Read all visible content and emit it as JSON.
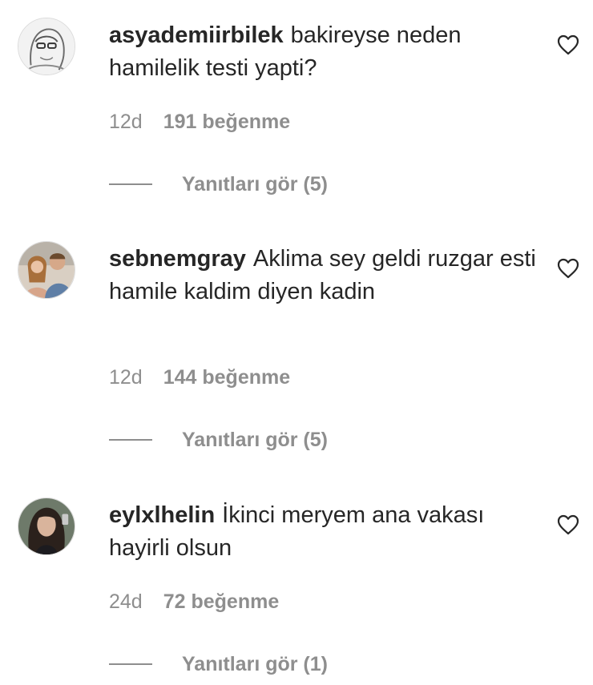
{
  "comments": [
    {
      "username": "asyademiirbilek",
      "text": "bakireyse neden hamilelik testi yapti?",
      "time": "12d",
      "likes": "191 beğenme",
      "replies": "Yanıtları gör (5)",
      "avatar_style": "sketch-portrait"
    },
    {
      "username": "sebnemgray",
      "text": "Aklima sey geldi ruzgar esti hamile kaldim diyen kadin",
      "time": "12d",
      "likes": "144 beğenme",
      "replies": "Yanıtları gör (5)",
      "avatar_style": "two-people-photo"
    },
    {
      "username": "eylxlhelin",
      "text": "İkinci meryem ana vakası hayirli olsun",
      "time": "24d",
      "likes": "72 beğenme",
      "replies": "Yanıtları gör (1)",
      "avatar_style": "dark-haired-portrait"
    }
  ],
  "icons": {
    "like": "heart-outline-icon"
  },
  "colors": {
    "text": "#262626",
    "secondary": "#8e8e8e",
    "background": "#ffffff"
  }
}
